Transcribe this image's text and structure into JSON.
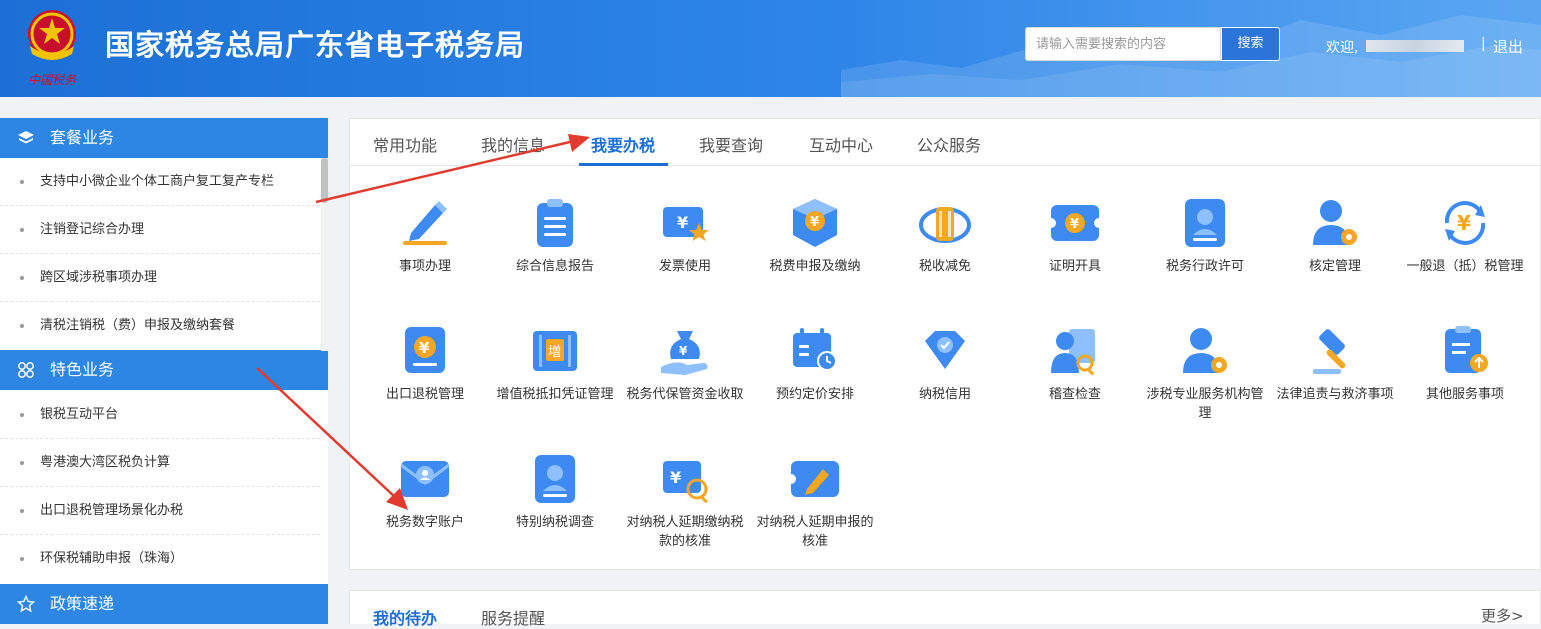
{
  "header": {
    "site_title": "国家税务总局广东省电子税务局",
    "logo_text": "中国税务",
    "search_placeholder": "请输入需要搜索的内容",
    "search_button": "搜索",
    "welcome": "欢迎,",
    "separator": "|",
    "logout": "退出"
  },
  "sidebar": {
    "sections": [
      {
        "title": "套餐业务",
        "icon": "layers-icon",
        "items": [
          "支持中小微企业个体工商户复工复产专栏",
          "注销登记综合办理",
          "跨区域涉税事项办理",
          "清税注销税（费）申报及缴纳套餐"
        ]
      },
      {
        "title": "特色业务",
        "icon": "grid-icon",
        "items": [
          "银税互动平台",
          "粤港澳大湾区税负计算",
          "出口退税管理场景化办税",
          "环保税辅助申报（珠海）"
        ]
      },
      {
        "title": "政策速递",
        "icon": "star-icon",
        "items": []
      }
    ]
  },
  "main": {
    "tabs": [
      "常用功能",
      "我的信息",
      "我要办税",
      "我要查询",
      "互动中心",
      "公众服务"
    ],
    "active_tab": "我要办税",
    "items": [
      {
        "label": "事项办理",
        "icon": "pencil-icon"
      },
      {
        "label": "综合信息报告",
        "icon": "clipboard-icon"
      },
      {
        "label": "发票使用",
        "icon": "invoice-icon"
      },
      {
        "label": "税费申报及缴纳",
        "icon": "box-icon"
      },
      {
        "label": "税收减免",
        "icon": "coins-icon"
      },
      {
        "label": "证明开具",
        "icon": "certificate-icon"
      },
      {
        "label": "税务行政许可",
        "icon": "permit-icon"
      },
      {
        "label": "核定管理",
        "icon": "user-gear-icon"
      },
      {
        "label": "一般退（抵）税管理",
        "icon": "refund-icon"
      },
      {
        "label": "出口退税管理",
        "icon": "export-refund-icon"
      },
      {
        "label": "增值税抵扣凭证管理",
        "icon": "vat-voucher-icon"
      },
      {
        "label": "税务代保管资金收取",
        "icon": "money-bag-icon"
      },
      {
        "label": "预约定价安排",
        "icon": "calendar-icon"
      },
      {
        "label": "纳税信用",
        "icon": "diamond-icon"
      },
      {
        "label": "稽查检查",
        "icon": "inspect-icon"
      },
      {
        "label": "涉税专业服务机构管理",
        "icon": "agency-icon"
      },
      {
        "label": "法律追责与救济事项",
        "icon": "gavel-icon"
      },
      {
        "label": "其他服务事项",
        "icon": "other-services-icon"
      },
      {
        "label": "税务数字账户",
        "icon": "digital-account-icon"
      },
      {
        "label": "特别纳税调查",
        "icon": "special-investigation-icon"
      },
      {
        "label": "对纳税人延期缴纳税款的核准",
        "icon": "deferred-payment-icon"
      },
      {
        "label": "对纳税人延期申报的核准",
        "icon": "deferred-filing-icon"
      }
    ]
  },
  "bottom": {
    "tabs": [
      "我的待办",
      "服务提醒"
    ],
    "more": "更多>"
  },
  "colors": {
    "brand": "#1d6fd6",
    "header": "#2f86e8",
    "sidebar_head": "#2d86e4",
    "arrow": "#e23b2e"
  }
}
